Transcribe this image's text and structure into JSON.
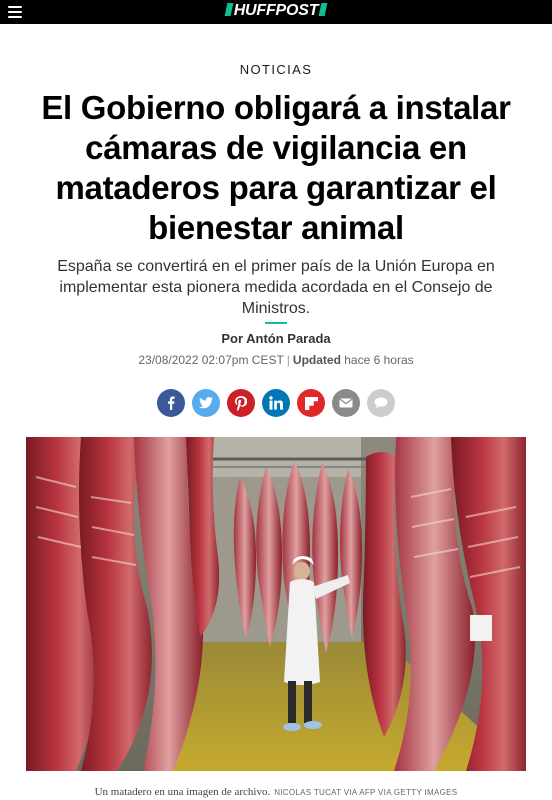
{
  "header": {
    "logo_text": "HUFFPOST",
    "logo_accent": "#0dbe98"
  },
  "article": {
    "section": "NOTICIAS",
    "headline": "El Gobierno obligará a instalar cámaras de vigilancia en mataderos para garantizar el bienestar animal",
    "dek": "España se convertirá en el primer país de la Unión Europa en implementar esta pionera medida acordada en el Consejo de Ministros.",
    "byline": "Por Antón Parada",
    "date": "23/08/2022 02:07pm CEST",
    "separator": "|",
    "updated_label": "Updated",
    "updated_value": "hace 6 horas"
  },
  "share": [
    {
      "name": "facebook-icon",
      "color": "#3b5998"
    },
    {
      "name": "twitter-icon",
      "color": "#55acee"
    },
    {
      "name": "pinterest-icon",
      "color": "#cb2027"
    },
    {
      "name": "linkedin-icon",
      "color": "#0077b5"
    },
    {
      "name": "flipboard-icon",
      "color": "#e12828"
    },
    {
      "name": "email-icon",
      "color": "#8a8a8a"
    },
    {
      "name": "comment-icon",
      "color": "#cccccc"
    }
  ],
  "image": {
    "caption": "Un matadero en una imagen de archivo.",
    "credit": "NICOLAS TUCAT VIA AFP VIA GETTY IMAGES"
  }
}
